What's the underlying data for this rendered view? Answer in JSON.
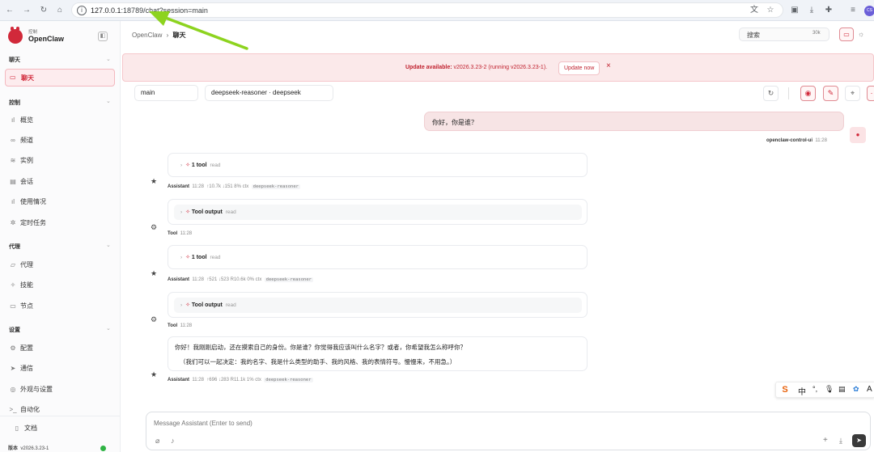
{
  "browser": {
    "url_host": "127.0.0.1",
    "url_path": ":18789/chat?session=main",
    "profile_initials": "CS"
  },
  "sidebar": {
    "brand_small": "控制",
    "brand_name": "OpenClaw",
    "sections": [
      {
        "title": "聊天",
        "items": [
          {
            "label": "聊天",
            "icon": "chat-icon",
            "active": true
          }
        ]
      },
      {
        "title": "控制",
        "items": [
          {
            "label": "概览",
            "icon": "bar-chart-icon"
          },
          {
            "label": "频道",
            "icon": "link-icon"
          },
          {
            "label": "实例",
            "icon": "radio-icon"
          },
          {
            "label": "会话",
            "icon": "document-icon"
          },
          {
            "label": "使用情况",
            "icon": "bar-chart-icon"
          },
          {
            "label": "定时任务",
            "icon": "loader-icon"
          }
        ]
      },
      {
        "title": "代理",
        "items": [
          {
            "label": "代理",
            "icon": "folder-icon"
          },
          {
            "label": "技能",
            "icon": "sparkle-icon"
          },
          {
            "label": "节点",
            "icon": "monitor-icon"
          }
        ]
      },
      {
        "title": "设置",
        "items": [
          {
            "label": "配置",
            "icon": "gear-icon"
          },
          {
            "label": "通信",
            "icon": "send-icon"
          },
          {
            "label": "外观与设置",
            "icon": "palette-icon"
          },
          {
            "label": "自动化",
            "icon": "terminal-icon"
          }
        ]
      }
    ],
    "docs_label": "文档",
    "version_label": "版本",
    "version": "v2026.3.23-1"
  },
  "header": {
    "breadcrumb_root": "OpenClaw",
    "breadcrumb_sep": "›",
    "breadcrumb_current": "聊天",
    "search_label": "搜索",
    "search_shortcut": "30k"
  },
  "banner": {
    "prefix": "Update available:",
    "message": " v2026.3.23-2 (running v2026.3.23-1).",
    "button": "Update now",
    "close": "×"
  },
  "toolbar": {
    "session": "main",
    "model": "deepseek-reasoner · deepseek"
  },
  "messages": {
    "user_text": "你好，你是谁？",
    "user_name": "openclaw-control-ui",
    "user_time": "11:28",
    "a1": {
      "tool_count": "1 tool",
      "tool_name": "read",
      "author": "Assistant",
      "time": "11:28",
      "stats": "↑10.7k  ↓151  8% ctx",
      "model": "deepseek-reasoner"
    },
    "t1": {
      "label": "Tool output",
      "tool_name": "read",
      "author": "Tool",
      "time": "11:28"
    },
    "a2": {
      "tool_count": "1 tool",
      "tool_name": "read",
      "author": "Assistant",
      "time": "11:28",
      "stats": "↑521  ↓523  R10.6k  0% ctx",
      "model": "deepseek-reasoner"
    },
    "t2": {
      "label": "Tool output",
      "tool_name": "read",
      "author": "Tool",
      "time": "11:28"
    },
    "a3": {
      "line1": "你好！我刚刚启动，还在摸索自己的身份。你是谁？你觉得我应该叫什么名字？或者，你希望我怎么称呼你？",
      "line2": "（我们可以一起决定：我的名字、我是什么类型的助手、我的风格、我的表情符号。慢慢来，不用急。）",
      "author": "Assistant",
      "time": "11:28",
      "stats": "↑696  ↓283  R11.1k  1% ctx",
      "model": "deepseek-reasoner"
    }
  },
  "composer": {
    "placeholder": "Message Assistant (Enter to send)"
  },
  "ime": {
    "mode": "中"
  },
  "colors": {
    "accent": "#d1293a",
    "banner_bg": "#fbe9ea",
    "user_bubble": "#f7e4e5"
  }
}
